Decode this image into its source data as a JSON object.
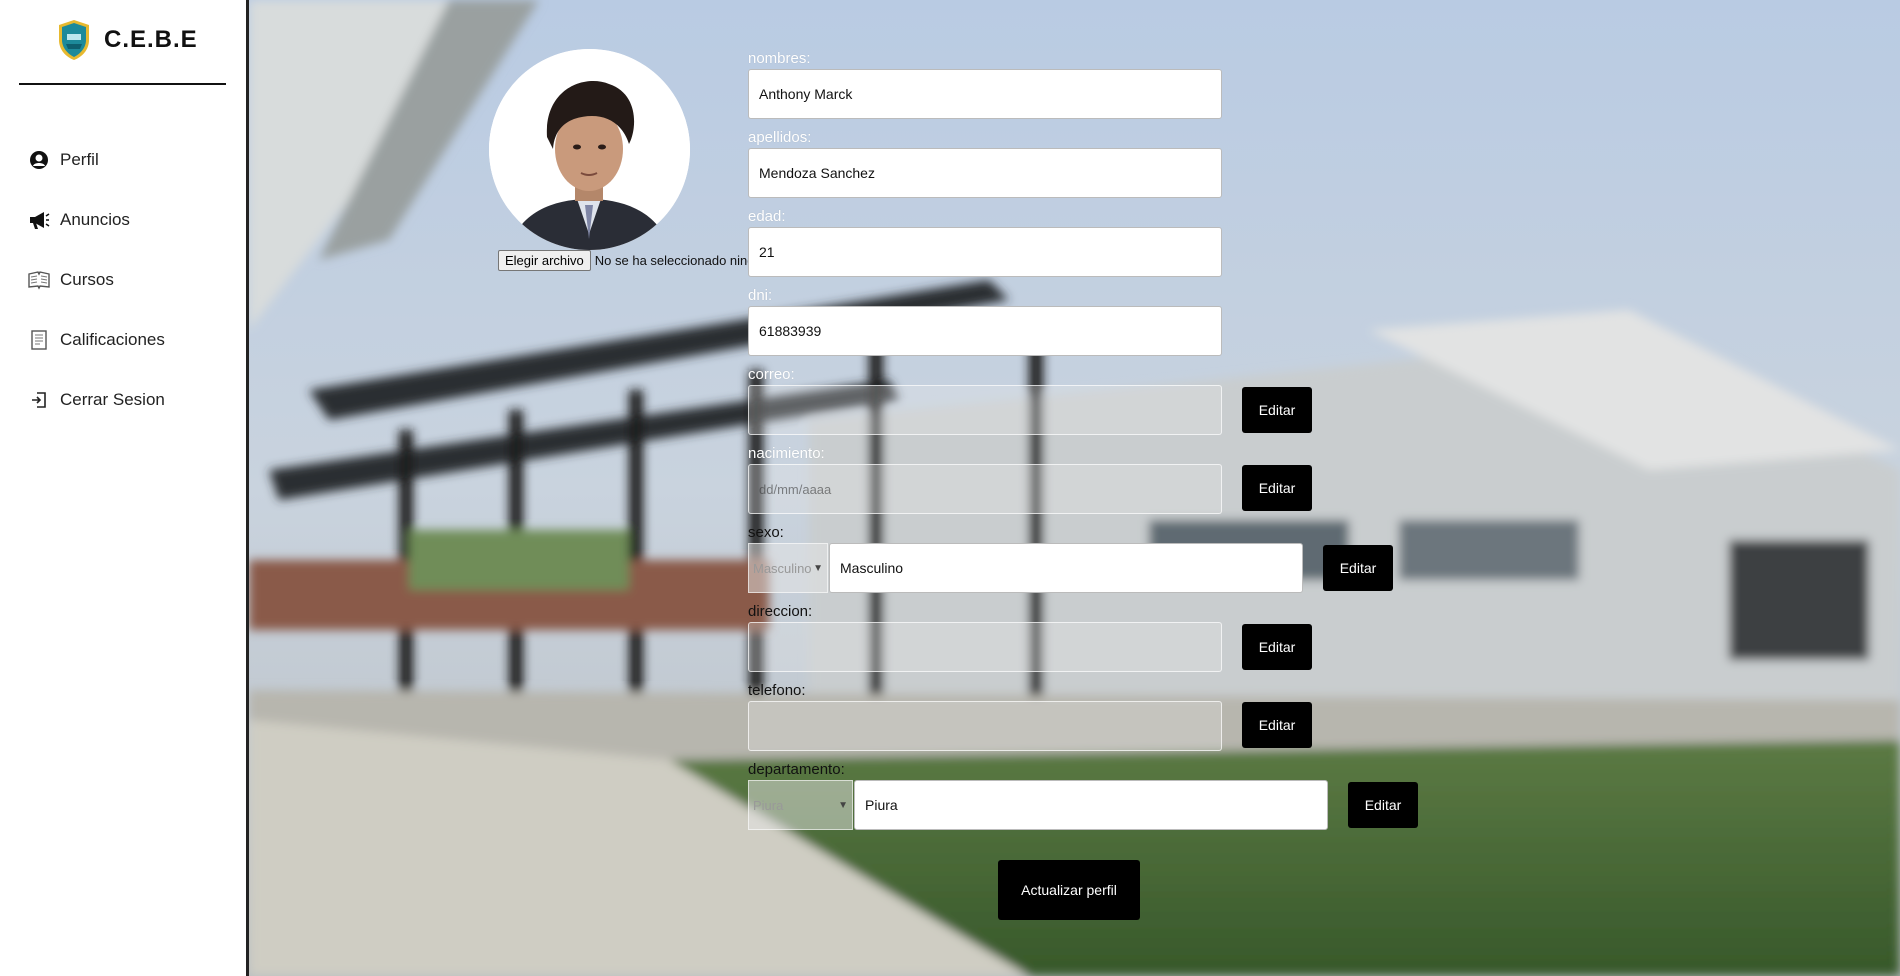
{
  "brand": {
    "name": "C.E.B.E"
  },
  "sidebar": {
    "items": [
      {
        "label": "Perfil",
        "icon": "user-circle-icon"
      },
      {
        "label": "Anuncios",
        "icon": "megaphone-icon"
      },
      {
        "label": "Cursos",
        "icon": "open-book-icon"
      },
      {
        "label": "Calificaciones",
        "icon": "document-icon"
      },
      {
        "label": "Cerrar Sesion",
        "icon": "logout-icon"
      }
    ]
  },
  "avatar": {
    "file_button": "Elegir archivo",
    "file_status": "No se ha seleccionado ningún archivo"
  },
  "form": {
    "nombres": {
      "label": "nombres:",
      "value": "Anthony Marck"
    },
    "apellidos": {
      "label": "apellidos:",
      "value": "Mendoza Sanchez"
    },
    "edad": {
      "label": "edad:",
      "value": "21"
    },
    "dni": {
      "label": "dni:",
      "value": "61883939"
    },
    "correo": {
      "label": "correo:",
      "value": ""
    },
    "nacimiento": {
      "label": "nacimiento:",
      "placeholder": "dd/mm/aaaa"
    },
    "sexo": {
      "label": "sexo:",
      "select_value": "Masculino",
      "value": "Masculino"
    },
    "direccion": {
      "label": "direccion:",
      "value": ""
    },
    "telefono": {
      "label": "telefono:",
      "value": ""
    },
    "departamento": {
      "label": "departamento:",
      "select_value": "Piura",
      "value": "Piura"
    },
    "edit_label": "Editar",
    "update_label": "Actualizar perfil"
  }
}
